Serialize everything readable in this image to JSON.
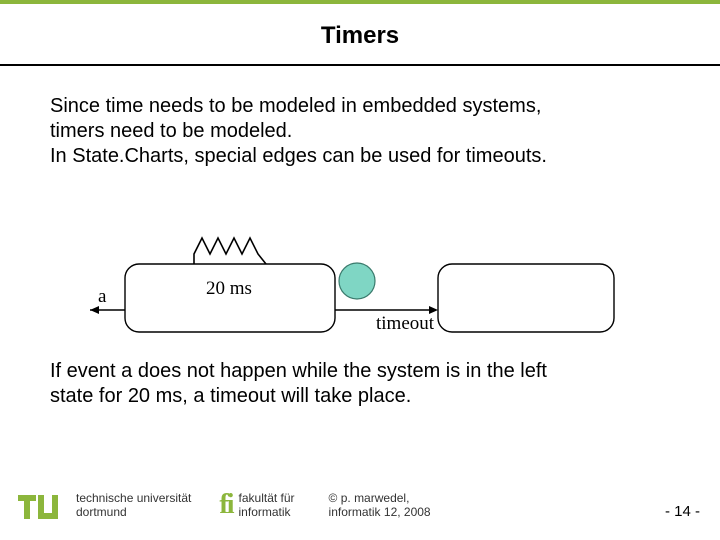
{
  "title": "Timers",
  "para1_line1": "Since time needs to be modeled in embedded systems,",
  "para1_line2": "timers need to be modeled.",
  "para1_line3": "In State.Charts, special edges can be used for timeouts.",
  "para2_line1": "If event a does not happen while the system is in the left",
  "para2_line2": "state for 20 ms, a timeout will take place.",
  "diagram": {
    "label_a": "a",
    "duration": "20 ms",
    "label_timeout": "timeout"
  },
  "footer": {
    "uni_line1": "technische universität",
    "uni_line2": "dortmund",
    "fi_line1": "fakultät für",
    "fi_line2": "informatik",
    "copy_line1": "©  p. marwedel,",
    "copy_line2": "informatik 12,  2008"
  },
  "pagenum": "-  14 -"
}
